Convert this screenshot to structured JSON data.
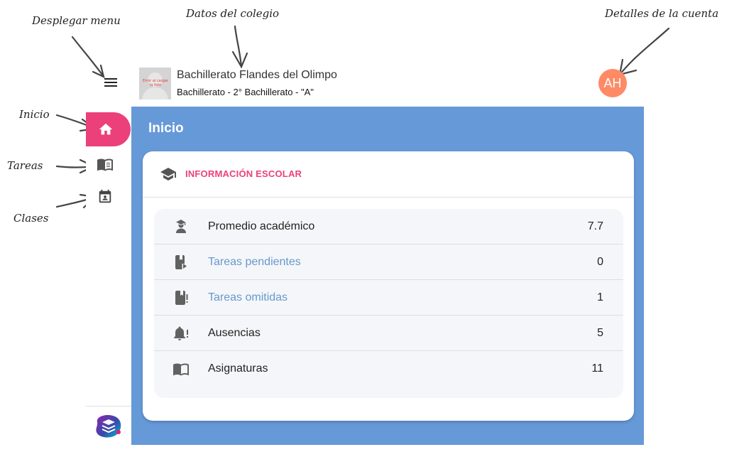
{
  "annotations": {
    "desplegar_menu": "Desplegar menu",
    "datos_colegio": "Datos del colegio",
    "detalles_cuenta": "Detalles de la cuenta",
    "inicio": "Inicio",
    "tareas": "Tareas",
    "clases": "Clases"
  },
  "header": {
    "photo_error": "Error al cargar la foto",
    "school_name": "Bachillerato Flandes del Olimpo",
    "school_sub": "Bachillerato - 2° Bachillerato - \"A\"",
    "avatar_initials": "AH"
  },
  "sidebar": {
    "items": [
      {
        "name": "Inicio",
        "icon": "home-icon",
        "active": true
      },
      {
        "name": "Tareas",
        "icon": "book-icon",
        "active": false
      },
      {
        "name": "Clases",
        "icon": "calendar-account-icon",
        "active": false
      }
    ]
  },
  "main": {
    "title": "Inicio",
    "card": {
      "header_label": "INFORMACIÓN ESCOLAR",
      "header_icon": "school-icon",
      "rows": [
        {
          "label": "Promedio académico",
          "value": "7.7",
          "icon": "student-icon",
          "link": false
        },
        {
          "label": "Tareas pendientes",
          "value": "0",
          "icon": "book-play-icon",
          "link": true
        },
        {
          "label": "Tareas omitidas",
          "value": "1",
          "icon": "book-alert-icon",
          "link": true
        },
        {
          "label": "Ausencias",
          "value": "5",
          "icon": "bell-alert-icon",
          "link": false
        },
        {
          "label": "Asignaturas",
          "value": "11",
          "icon": "book-open-icon",
          "link": false
        }
      ]
    }
  },
  "colors": {
    "primary": "#6699d8",
    "accent": "#ec407a",
    "avatar": "#ff8a65",
    "link": "#6699cc",
    "icon": "#616161"
  }
}
